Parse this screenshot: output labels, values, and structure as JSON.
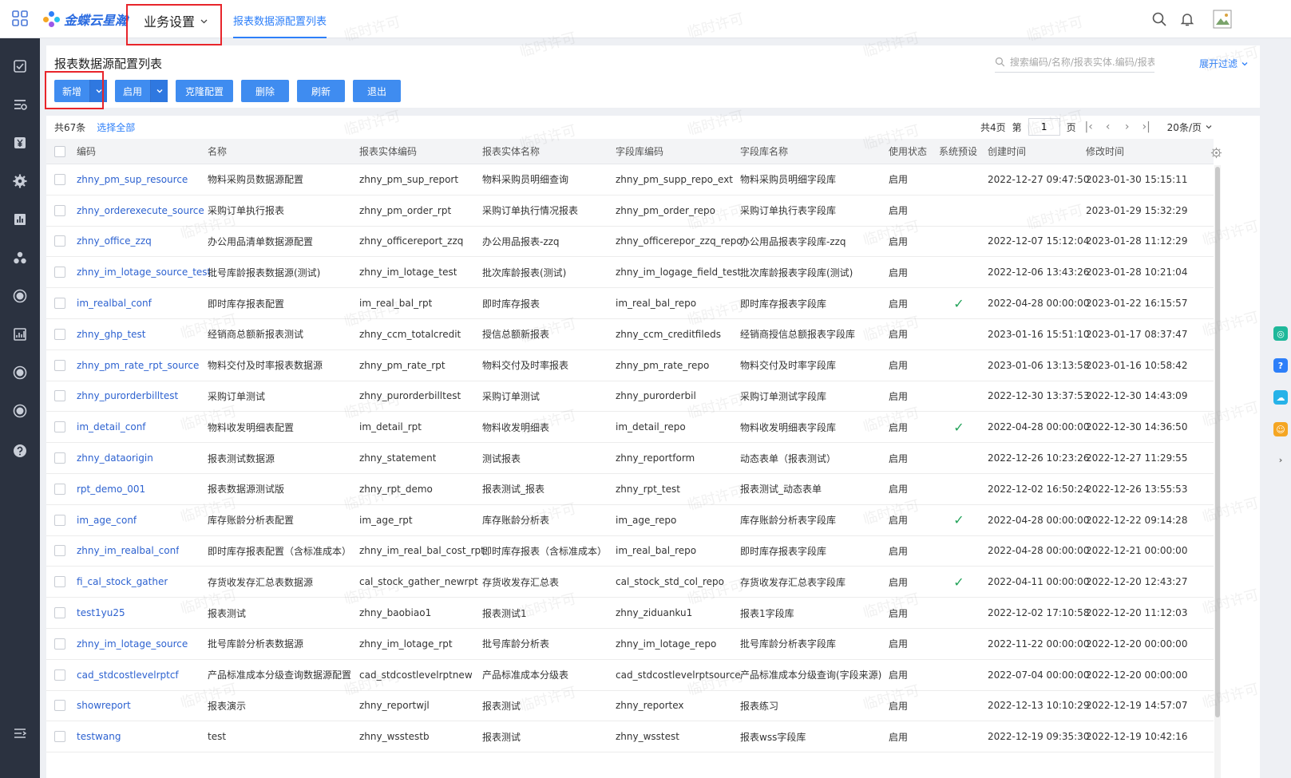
{
  "header": {
    "logo_text": "金蝶云星瀚",
    "menu_title": "业务设置",
    "active_tab": "报表数据源配置列表"
  },
  "page": {
    "title": "报表数据源配置列表",
    "search_placeholder": "搜索编码/名称/报表实体.编码/报表",
    "filter_link": "展开过滤"
  },
  "toolbar": {
    "new_label": "新增",
    "enable_label": "启用",
    "clone_label": "克隆配置",
    "delete_label": "删除",
    "refresh_label": "刷新",
    "exit_label": "退出"
  },
  "list_info": {
    "total": "共67条",
    "select_all": "选择全部"
  },
  "pager": {
    "total_pages": "共4页",
    "page_prefix": "第",
    "current_page": "1",
    "page_suffix": "页",
    "page_size": "20条/页"
  },
  "table": {
    "headers": [
      "编码",
      "名称",
      "报表实体编码",
      "报表实体名称",
      "字段库编码",
      "字段库名称",
      "使用状态",
      "系统预设",
      "创建时间",
      "修改时间"
    ],
    "rows": [
      {
        "code": "zhny_pm_sup_resource",
        "name": "物料采购员数据源配置",
        "entity_code": "zhny_pm_sup_report",
        "entity_name": "物料采购员明细查询",
        "repo_code": "zhny_pm_supp_repo_ext",
        "repo_name": "物料采购员明细字段库",
        "status": "启用",
        "preset": false,
        "created": "2022-12-27 09:47:50",
        "modified": "2023-01-30 15:15:11"
      },
      {
        "code": "zhny_orderexecute_source",
        "name": "采购订单执行报表",
        "entity_code": "zhny_pm_order_rpt",
        "entity_name": "采购订单执行情况报表",
        "repo_code": "zhny_pm_order_repo",
        "repo_name": "采购订单执行表字段库",
        "status": "启用",
        "preset": false,
        "created": "",
        "modified": "2023-01-29 15:32:29"
      },
      {
        "code": "zhny_office_zzq",
        "name": "办公用品清单数据源配置",
        "entity_code": "zhny_officereport_zzq",
        "entity_name": "办公用品报表-zzq",
        "repo_code": "zhny_officerepor_zzq_repo",
        "repo_name": "办公用品报表字段库-zzq",
        "status": "启用",
        "preset": false,
        "created": "2022-12-07 15:12:04",
        "modified": "2023-01-28 11:12:29"
      },
      {
        "code": "zhny_im_lotage_source_test",
        "name": "批号库龄报表数据源(测试)",
        "entity_code": "zhny_im_lotage_test",
        "entity_name": "批次库龄报表(测试)",
        "repo_code": "zhny_im_logage_field_test",
        "repo_name": "批次库龄报表字段库(测试)",
        "status": "启用",
        "preset": false,
        "created": "2022-12-06 13:43:26",
        "modified": "2023-01-28 10:21:04"
      },
      {
        "code": "im_realbal_conf",
        "name": "即时库存报表配置",
        "entity_code": "im_real_bal_rpt",
        "entity_name": "即时库存报表",
        "repo_code": "im_real_bal_repo",
        "repo_name": "即时库存报表字段库",
        "status": "启用",
        "preset": true,
        "created": "2022-04-28 00:00:00",
        "modified": "2023-01-22 16:15:57"
      },
      {
        "code": "zhny_ghp_test",
        "name": "经销商总额新报表测试",
        "entity_code": "zhny_ccm_totalcredit",
        "entity_name": "授信总额新报表",
        "repo_code": "zhny_ccm_creditfileds",
        "repo_name": "经销商授信总额报表字段库",
        "status": "启用",
        "preset": false,
        "created": "2023-01-16 15:51:10",
        "modified": "2023-01-17 08:37:47"
      },
      {
        "code": "zhny_pm_rate_rpt_source",
        "name": "物料交付及时率报表数据源",
        "entity_code": "zhny_pm_rate_rpt",
        "entity_name": "物料交付及时率报表",
        "repo_code": "zhny_pm_rate_repo",
        "repo_name": "物料交付及时率字段库",
        "status": "启用",
        "preset": false,
        "created": "2023-01-06 13:13:58",
        "modified": "2023-01-16 10:58:42"
      },
      {
        "code": "zhny_purorderbilltest",
        "name": "采购订单测试",
        "entity_code": "zhny_purorderbilltest",
        "entity_name": "采购订单测试",
        "repo_code": "zhny_purorderbil",
        "repo_name": "采购订单测试字段库",
        "status": "启用",
        "preset": false,
        "created": "2022-12-30 13:37:53",
        "modified": "2022-12-30 14:43:09"
      },
      {
        "code": "im_detail_conf",
        "name": "物料收发明细表配置",
        "entity_code": "im_detail_rpt",
        "entity_name": "物料收发明细表",
        "repo_code": "im_detail_repo",
        "repo_name": "物料收发明细表字段库",
        "status": "启用",
        "preset": true,
        "created": "2022-04-28 00:00:00",
        "modified": "2022-12-30 14:36:50"
      },
      {
        "code": "zhny_dataorigin",
        "name": "报表测试数据源",
        "entity_code": "zhny_statement",
        "entity_name": "测试报表",
        "repo_code": "zhny_reportform",
        "repo_name": "动态表单（报表测试）",
        "status": "启用",
        "preset": false,
        "created": "2022-12-26 10:23:26",
        "modified": "2022-12-27 11:29:55"
      },
      {
        "code": "rpt_demo_001",
        "name": "报表数据源测试版",
        "entity_code": "zhny_rpt_demo",
        "entity_name": "报表测试_报表",
        "repo_code": "zhny_rpt_test",
        "repo_name": "报表测试_动态表单",
        "status": "启用",
        "preset": false,
        "created": "2022-12-02 16:50:24",
        "modified": "2022-12-26 13:55:53"
      },
      {
        "code": "im_age_conf",
        "name": "库存账龄分析表配置",
        "entity_code": "im_age_rpt",
        "entity_name": "库存账龄分析表",
        "repo_code": "im_age_repo",
        "repo_name": "库存账龄分析表字段库",
        "status": "启用",
        "preset": true,
        "created": "2022-04-28 00:00:00",
        "modified": "2022-12-22 09:14:28"
      },
      {
        "code": "zhny_im_realbal_conf",
        "name": "即时库存报表配置（含标准成本）",
        "entity_code": "zhny_im_real_bal_cost_rpt",
        "entity_name": "即时库存报表（含标准成本）",
        "repo_code": "im_real_bal_repo",
        "repo_name": "即时库存报表字段库",
        "status": "启用",
        "preset": false,
        "created": "2022-04-28 00:00:00",
        "modified": "2022-12-21 00:00:00"
      },
      {
        "code": "fi_cal_stock_gather",
        "name": "存货收发存汇总表数据源",
        "entity_code": "cal_stock_gather_newrpt",
        "entity_name": "存货收发存汇总表",
        "repo_code": "cal_stock_std_col_repo",
        "repo_name": "存货收发存汇总表字段库",
        "status": "启用",
        "preset": true,
        "created": "2022-04-11 00:00:00",
        "modified": "2022-12-20 12:43:27"
      },
      {
        "code": "test1yu25",
        "name": "报表测试",
        "entity_code": "zhny_baobiao1",
        "entity_name": "报表测试1",
        "repo_code": "zhny_ziduanku1",
        "repo_name": "报表1字段库",
        "status": "启用",
        "preset": false,
        "created": "2022-12-02 17:10:58",
        "modified": "2022-12-20 11:12:03"
      },
      {
        "code": "zhny_im_lotage_source",
        "name": "批号库龄分析表数据源",
        "entity_code": "zhny_im_lotage_rpt",
        "entity_name": "批号库龄分析表",
        "repo_code": "zhny_im_lotage_repo",
        "repo_name": "批号库龄分析表字段库",
        "status": "启用",
        "preset": false,
        "created": "2022-11-22 00:00:00",
        "modified": "2022-12-20 00:00:00"
      },
      {
        "code": "cad_stdcostlevelrptcf",
        "name": "产品标准成本分级查询数据源配置",
        "entity_code": "cad_stdcostlevelrptnew",
        "entity_name": "产品标准成本分级表",
        "repo_code": "cad_stdcostlevelrptsource",
        "repo_name": "产品标准成本分级查询(字段来源)",
        "status": "启用",
        "preset": false,
        "created": "2022-07-04 00:00:00",
        "modified": "2022-12-20 00:00:00"
      },
      {
        "code": "showreport",
        "name": "报表演示",
        "entity_code": "zhny_reportwjl",
        "entity_name": "报表测试",
        "repo_code": "zhny_reportex",
        "repo_name": "报表练习",
        "status": "启用",
        "preset": false,
        "created": "2022-12-13 10:10:29",
        "modified": "2022-12-19 14:57:07"
      },
      {
        "code": "testwang",
        "name": "test",
        "entity_code": "zhny_wsstestb",
        "entity_name": "报表测试",
        "repo_code": "zhny_wsstest",
        "repo_name": "报表wss字段库",
        "status": "启用",
        "preset": false,
        "created": "2022-12-19 09:35:30",
        "modified": "2022-12-19 10:42:16"
      }
    ]
  },
  "watermark": "临时许可",
  "colors": {
    "accent": "#3f8cf0",
    "link": "#2d62d0",
    "sidebar": "#2b3240",
    "highlight_box": "#e8252b",
    "check": "#23a35a"
  }
}
